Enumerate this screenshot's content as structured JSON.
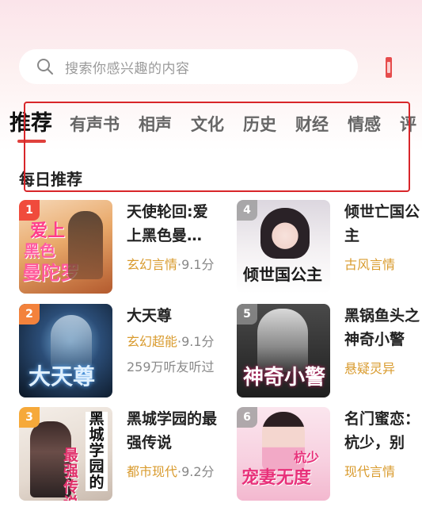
{
  "search": {
    "placeholder": "搜索你感兴趣的内容",
    "icon": "search-icon"
  },
  "tabs": [
    {
      "label": "推荐",
      "active": true
    },
    {
      "label": "有声书"
    },
    {
      "label": "相声"
    },
    {
      "label": "文化"
    },
    {
      "label": "历史"
    },
    {
      "label": "财经"
    },
    {
      "label": "情感"
    },
    {
      "label": "评"
    }
  ],
  "section": {
    "title": "每日推荐"
  },
  "books": [
    {
      "rank": "1",
      "title": "天使轮回:爱上黑色曼…",
      "category": "玄幻言情",
      "rating": "·9.1分",
      "cover_text": "爱上黑色曼陀罗"
    },
    {
      "rank": "2",
      "title": "大天尊",
      "category": "玄幻超能",
      "rating": "·9.1分",
      "listeners": "259万听友听过",
      "cover_text": "大天尊"
    },
    {
      "rank": "3",
      "title": "黑城学园的最强传说",
      "category": "都市现代",
      "rating": "·9.2分",
      "cover_text": "黑城学园的最强传说"
    },
    {
      "rank": "4",
      "title": "倾世亡国公主",
      "category": "古风言情",
      "rating": "",
      "cover_text": "倾世亡国公主"
    },
    {
      "rank": "5",
      "title": "黑锅鱼头之神奇小警",
      "category": "悬疑灵异",
      "rating": "",
      "cover_text": "神奇小警"
    },
    {
      "rank": "6",
      "title": "名门蜜恋：杭少，别",
      "category": "现代言情",
      "rating": "",
      "cover_text": "杭少宠妻无度"
    }
  ],
  "colors": {
    "accent": "#e0403c",
    "category": "#d99b2e",
    "highlight_box": "#d8262a"
  }
}
